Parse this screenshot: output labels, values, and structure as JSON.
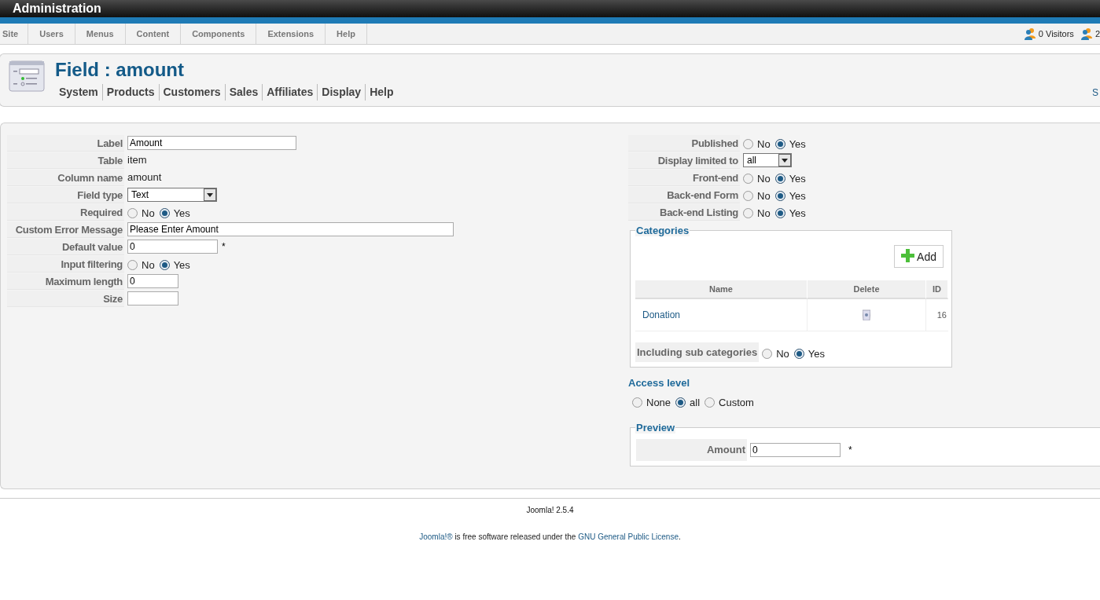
{
  "header": {
    "title": "Administration"
  },
  "menu": [
    {
      "label": "Site"
    },
    {
      "label": "Users"
    },
    {
      "label": "Menus"
    },
    {
      "label": "Content"
    },
    {
      "label": "Components"
    },
    {
      "label": "Extensions"
    },
    {
      "label": "Help"
    }
  ],
  "status": [
    {
      "text": "0 Visitors"
    },
    {
      "text": "2"
    }
  ],
  "toolbar": {
    "title": "Field : amount",
    "tabs": [
      "System",
      "Products",
      "Customers",
      "Sales",
      "Affiliates",
      "Display",
      "Help"
    ],
    "corner_link": "S"
  },
  "fields_left": [
    {
      "kind": "input",
      "label": "Label",
      "value": "Amount"
    },
    {
      "kind": "text",
      "label": "Table",
      "value": "item"
    },
    {
      "kind": "text",
      "label": "Column name",
      "value": "amount"
    },
    {
      "kind": "select",
      "label": "Field type",
      "value": "Text"
    },
    {
      "kind": "radio",
      "label": "Required",
      "options": [
        {
          "label": "No",
          "selected": false
        },
        {
          "label": "Yes",
          "selected": true
        }
      ]
    },
    {
      "kind": "input",
      "label": "Custom Error Message",
      "value": "Please Enter Amount"
    },
    {
      "kind": "input",
      "label": "Default value",
      "value": "0",
      "suffix": "*"
    },
    {
      "kind": "radio",
      "label": "Input filtering",
      "options": [
        {
          "label": "No",
          "selected": false
        },
        {
          "label": "Yes",
          "selected": true
        }
      ]
    },
    {
      "kind": "input",
      "label": "Maximum length",
      "value": "0"
    },
    {
      "kind": "input",
      "label": "Size"
    }
  ],
  "fields_right": [
    {
      "kind": "radio",
      "label": "Published",
      "options": [
        {
          "label": "No",
          "selected": false
        },
        {
          "label": "Yes",
          "selected": true
        }
      ]
    },
    {
      "kind": "select",
      "label": "Display limited to",
      "value": "all"
    },
    {
      "kind": "radio",
      "label": "Front-end",
      "options": [
        {
          "label": "No",
          "selected": false
        },
        {
          "label": "Yes",
          "selected": true
        }
      ]
    },
    {
      "kind": "radio",
      "label": "Back-end Form",
      "options": [
        {
          "label": "No",
          "selected": false
        },
        {
          "label": "Yes",
          "selected": true
        }
      ]
    },
    {
      "kind": "radio",
      "label": "Back-end Listing",
      "options": [
        {
          "label": "No",
          "selected": false
        },
        {
          "label": "Yes",
          "selected": true
        }
      ]
    }
  ],
  "categories": {
    "title": "Categories",
    "add_button": "Add",
    "columns": [
      "Name",
      "Delete",
      "ID"
    ],
    "rows": [
      {
        "name": "Donation",
        "id": "16"
      }
    ],
    "sub_categories": {
      "label": "Including sub categories",
      "options": [
        {
          "label": "No",
          "selected": false
        },
        {
          "label": "Yes",
          "selected": true
        }
      ]
    }
  },
  "access_level": {
    "title": "Access level",
    "options": [
      {
        "label": "None",
        "selected": false
      },
      {
        "label": "all",
        "selected": true
      },
      {
        "label": "Custom",
        "selected": false
      }
    ]
  },
  "preview": {
    "title": "Preview",
    "label": "Amount",
    "value": "0",
    "suffix": "*"
  },
  "footer": {
    "version": "Joomla! 2.5.4",
    "license": [
      {
        "kind": "link",
        "text": "Joomla!®"
      },
      {
        "kind": "text",
        "text": " is free software released under the "
      },
      {
        "kind": "link",
        "text": "GNU General Public License"
      },
      {
        "kind": "text",
        "text": "."
      }
    ]
  }
}
